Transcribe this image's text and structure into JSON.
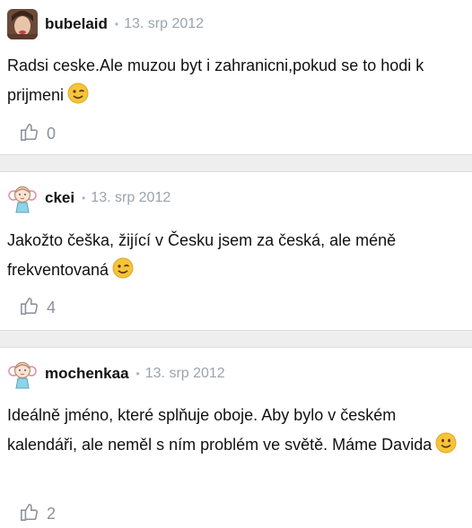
{
  "comments": [
    {
      "username": "bubelaid",
      "separator": "•",
      "date": "13. srp 2012",
      "text": "Radsi ceske.Ale muzou byt i zahranicni,pokud se to hodi k prijmeni",
      "emoji": "wink-emoji",
      "likes": "0",
      "avatar": "photo-avatar"
    },
    {
      "username": "ckei",
      "separator": "•",
      "date": "13. srp 2012",
      "text": "Jakožto češka, žijící v Česku jsem za česká, ale méně frekventovaná",
      "emoji": "wink-emoji",
      "likes": "4",
      "avatar": "girl-illustration-avatar"
    },
    {
      "username": "mochenkaa",
      "separator": "•",
      "date": "13. srp 2012",
      "text": "Ideálně jméno, které splňuje oboje. Aby bylo v českém kalendáři, ale neměl s ním problém ve světě. Máme Davida",
      "emoji": "smile-emoji",
      "likes": "2",
      "avatar": "girl-illustration-avatar"
    }
  ],
  "colors": {
    "divider": "#eeeeee",
    "meta": "#9aa3ad",
    "text": "#111111",
    "emoji": "#f6c33b"
  }
}
